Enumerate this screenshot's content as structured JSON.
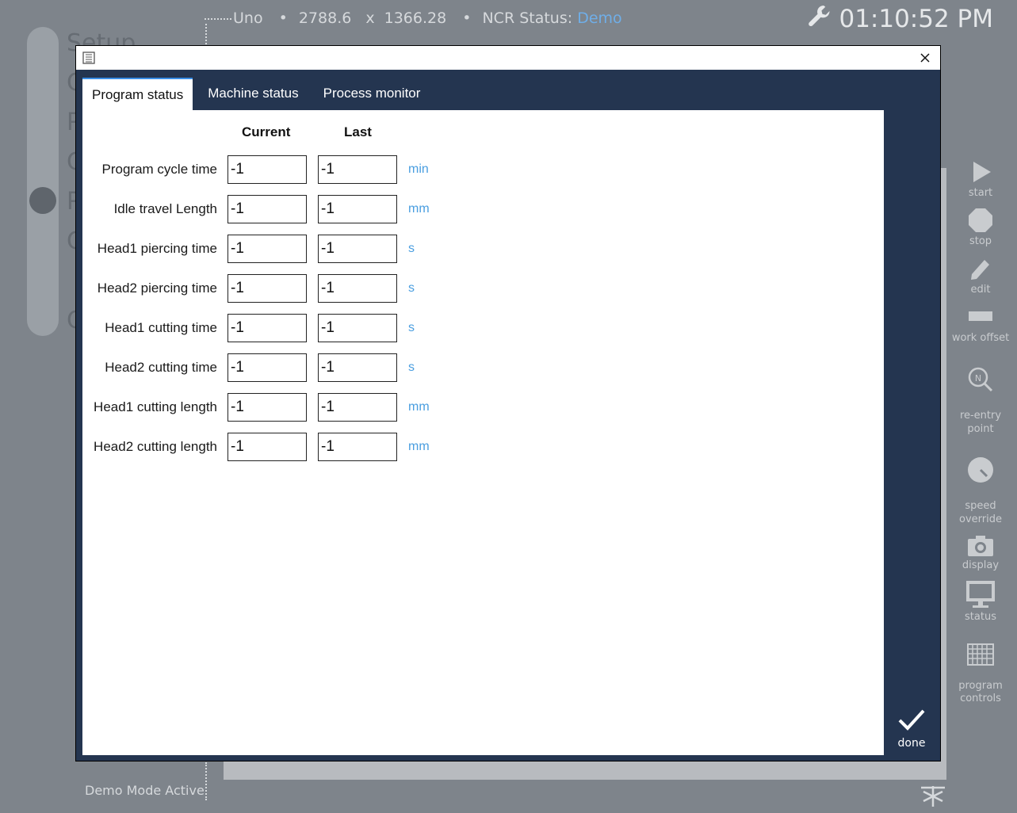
{
  "topbar": {
    "machine": "Uno",
    "x_pos": "2788.6",
    "times": "x",
    "y_pos": "1366.28",
    "ncr_label": "NCR Status:",
    "ncr_value": "Demo"
  },
  "clock": {
    "time": "01:10:52 PM",
    "icon": "wrench-icon"
  },
  "left_menu": {
    "items": [
      "Setup",
      "C",
      "P",
      "C",
      "P",
      "C",
      "C"
    ]
  },
  "footer": {
    "demo_mode": "Demo Mode Active"
  },
  "right_bar": {
    "items": [
      {
        "label": "start",
        "icon": "play-icon"
      },
      {
        "label": "stop",
        "icon": "stop-icon"
      },
      {
        "label": "edit",
        "icon": "pencil-icon"
      },
      {
        "label": "work offset",
        "icon": "offset-icon"
      },
      {
        "label": "re-entry\npoint",
        "icon": "reentry-icon"
      },
      {
        "label": "speed\noverride",
        "icon": "gauge-icon"
      },
      {
        "label": "display",
        "icon": "camera-icon"
      },
      {
        "label": "status",
        "icon": "monitor-icon"
      },
      {
        "label": "program\ncontrols",
        "icon": "grid-icon"
      }
    ]
  },
  "dialog": {
    "tabs": [
      "Program status",
      "Machine status",
      "Process monitor"
    ],
    "active_tab": "Program status",
    "columns": {
      "current": "Current",
      "last": "Last"
    },
    "rows": [
      {
        "label": "Program cycle time",
        "current": "-1",
        "last": "-1",
        "unit": "min"
      },
      {
        "label": "Idle travel Length",
        "current": "-1",
        "last": "-1",
        "unit": "mm"
      },
      {
        "label": "Head1 piercing time",
        "current": "-1",
        "last": "-1",
        "unit": "s"
      },
      {
        "label": "Head2 piercing time",
        "current": "-1",
        "last": "-1",
        "unit": "s"
      },
      {
        "label": "Head1 cutting time",
        "current": "-1",
        "last": "-1",
        "unit": "s"
      },
      {
        "label": "Head2 cutting time",
        "current": "-1",
        "last": "-1",
        "unit": "s"
      },
      {
        "label": "Head1 cutting length",
        "current": "-1",
        "last": "-1",
        "unit": "mm"
      },
      {
        "label": "Head2 cutting length",
        "current": "-1",
        "last": "-1",
        "unit": "mm"
      }
    ],
    "done_label": "done"
  },
  "colors": {
    "dialog_bg": "#243550",
    "accent": "#3a8ee6",
    "unit": "#4a9ee0",
    "ncr_value": "#6faee8"
  }
}
